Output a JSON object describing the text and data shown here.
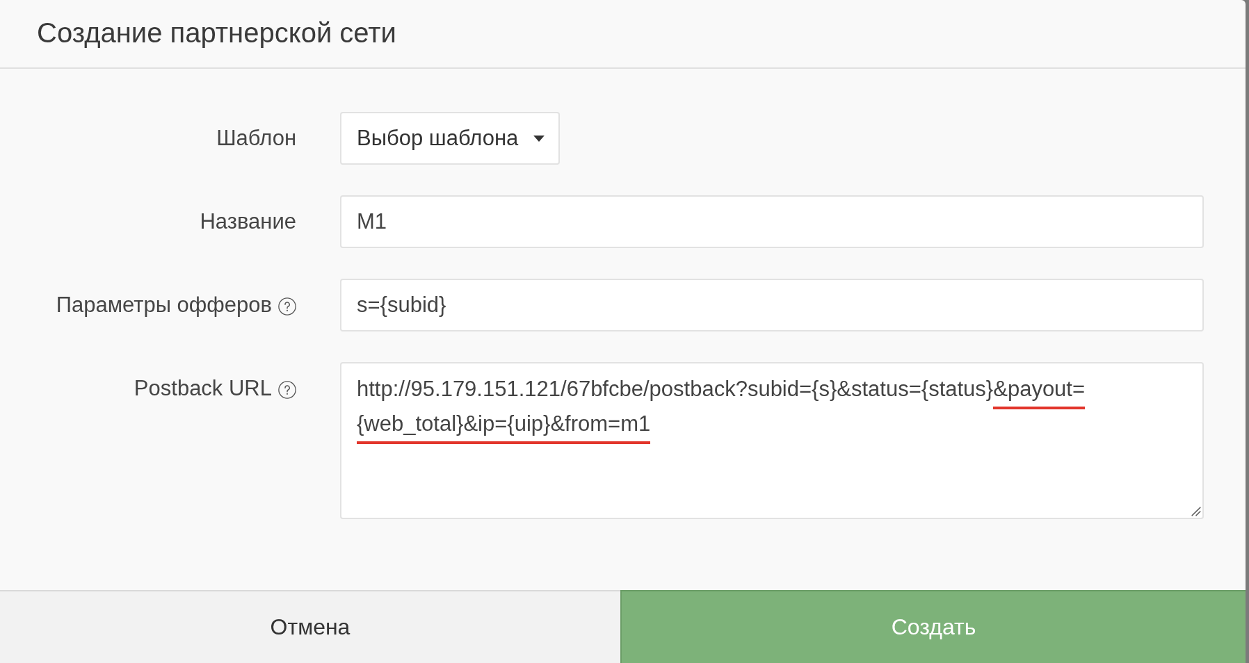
{
  "dialog": {
    "title": "Создание партнерской сети"
  },
  "form": {
    "fields": [
      {
        "kind": "dropdown",
        "label": "Шаблон",
        "value": "Выбор шаблона",
        "help": false
      },
      {
        "kind": "text",
        "label": "Название",
        "value": "M1",
        "help": false
      },
      {
        "kind": "text",
        "label": "Параметры офферов",
        "value": "s={subid}",
        "help": true
      },
      {
        "kind": "textarea",
        "label": "Postback URL",
        "help": true,
        "value_parts": [
          {
            "text": "http://95.179.151.121/67bfcbe/postback?subid={s}&status={status}",
            "marked": false
          },
          {
            "text": "&payout=",
            "marked": true
          },
          {
            "text": "{web_total}&ip={uip}&from=m1",
            "marked": true
          }
        ]
      }
    ]
  },
  "buttons": [
    {
      "kind": "secondary",
      "label": "Отмена"
    },
    {
      "kind": "primary",
      "label": "Создать"
    }
  ]
}
